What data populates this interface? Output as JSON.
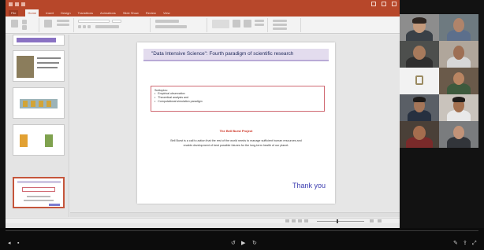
{
  "ppt": {
    "tabs": [
      "File",
      "Home",
      "Insert",
      "Design",
      "Transitions",
      "Animations",
      "Slide Show",
      "Review",
      "View"
    ]
  },
  "slide": {
    "title": "\"Data Intensive Science\": Fourth paradigm of scientific research",
    "subtopics_header": "Subtopics:",
    "subtopics": [
      "Empirical observation",
      "Theoretical analysis and",
      "Computational simulation paradigm"
    ],
    "quote_heading": "The Bell Burst Project",
    "quote_body": "Bell Burst is a call to action that the rest of the world needs to manage sufficient human resources and enable development of best possible futures for the long-term health of our planet.",
    "thank_you": "Thank you"
  },
  "colors": {
    "ribbon_accent": "#b7472a",
    "title_text": "#1f2a5a",
    "quote_heading": "#cc2f1f",
    "thank_you": "#3a3bb0"
  }
}
